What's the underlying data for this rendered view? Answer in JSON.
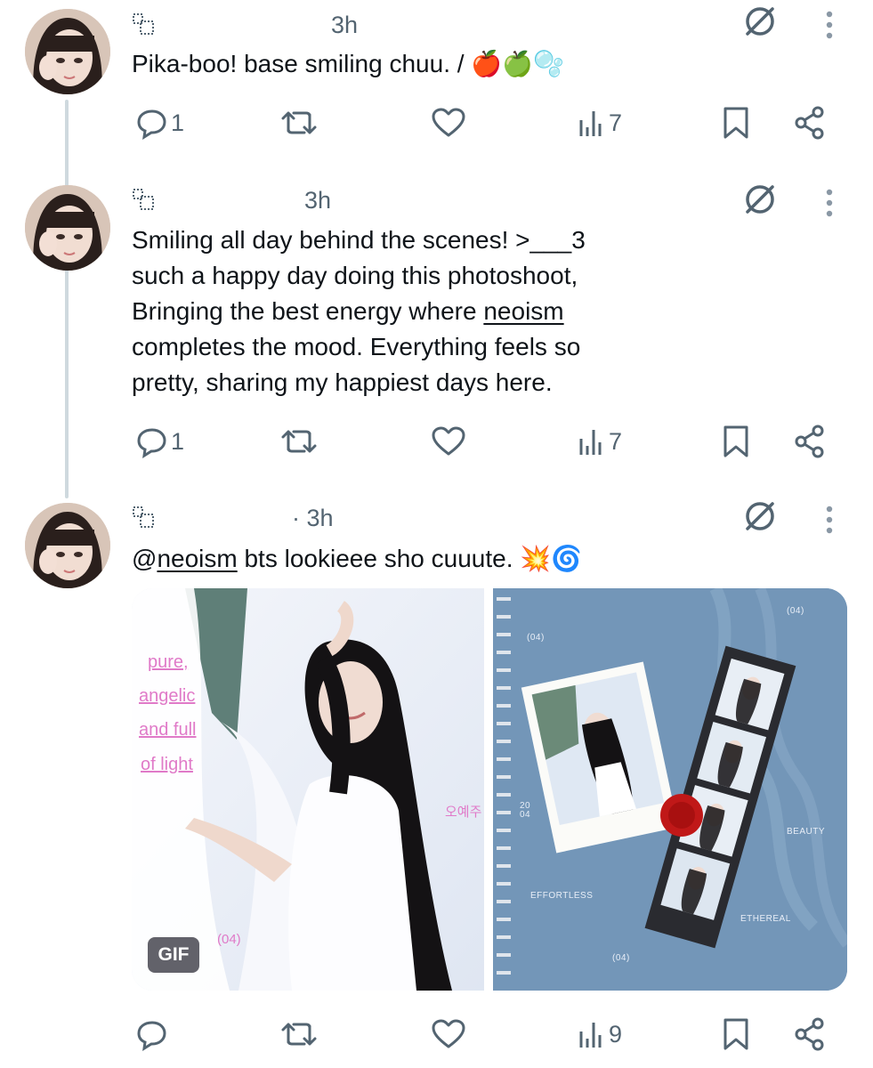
{
  "tweets": [
    {
      "time": "3h",
      "text_lines": [
        {
          "parts": [
            {
              "t": "Pika-boo! base smiling chuu. / 🍎🍏🫧",
              "link": false
            }
          ]
        }
      ],
      "actions": {
        "replies": "1",
        "views": "7"
      }
    },
    {
      "time": "3h",
      "text_lines": [
        {
          "parts": [
            {
              "t": "Smiling all day behind the scenes! >___3",
              "link": false
            }
          ]
        },
        {
          "parts": [
            {
              "t": "such a happy day doing this photoshoot,",
              "link": false
            }
          ]
        },
        {
          "parts": [
            {
              "t": "Bringing  the  best energy  where  ",
              "link": false
            },
            {
              "t": "neoism",
              "link": true
            }
          ]
        },
        {
          "parts": [
            {
              "t": "completes the mood. Everything feels so",
              "link": false
            }
          ]
        },
        {
          "parts": [
            {
              "t": "pretty,  sharing  my  happiest  days  here.",
              "link": false
            }
          ]
        }
      ],
      "actions": {
        "replies": "1",
        "views": "7"
      }
    },
    {
      "time": "· 3h",
      "text_lines": [
        {
          "parts": [
            {
              "t": "@",
              "link": false
            },
            {
              "t": "neoism",
              "link": true
            },
            {
              "t": " bts lookieee sho cuuute. 💥🌀",
              "link": false
            }
          ]
        }
      ],
      "actions": {
        "replies": "",
        "views": "9"
      }
    }
  ],
  "media": {
    "left": {
      "pink_words": [
        "pure,",
        "angelic",
        "and full",
        "of light"
      ],
      "korean_name": "오예주",
      "code": "(04)",
      "gif_label": "GIF"
    },
    "right": {
      "code_top_right": "(04)",
      "code_top_left": "(04)",
      "date": "20\n04",
      "beauty": "BEAUTY",
      "effortless": "EFFORTLESS",
      "ethereal": "ETHEREAL",
      "code_bottom": "(04)"
    }
  },
  "icon_names": [
    "reply-icon",
    "repost-icon",
    "like-icon",
    "views-icon",
    "bookmark-icon",
    "share-icon",
    "grok-icon",
    "more-icon",
    "community-icon"
  ],
  "colors": {
    "text": "#0f1419",
    "muted": "#536471",
    "thread": "#cfd9de",
    "pink": "#e07ac8",
    "denim": "#6f93b6"
  }
}
